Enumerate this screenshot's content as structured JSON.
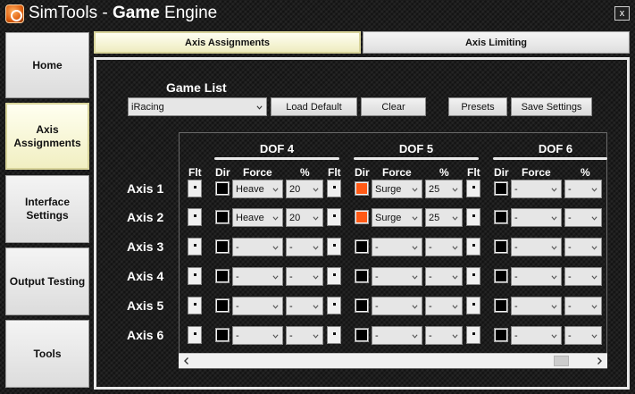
{
  "window": {
    "title_part1": "SimTools - ",
    "title_bold": "Game",
    "title_part2": " Engine",
    "close_label": "x"
  },
  "sidebar": {
    "items": [
      {
        "label": "Home"
      },
      {
        "label": "Axis Assignments"
      },
      {
        "label": "Interface Settings"
      },
      {
        "label": "Output Testing"
      },
      {
        "label": "Tools"
      }
    ],
    "active_index": 1
  },
  "tabs": [
    {
      "label": "Axis Assignments",
      "active": true
    },
    {
      "label": "Axis Limiting",
      "active": false
    }
  ],
  "game_list": {
    "label": "Game List",
    "selected": "iRacing"
  },
  "buttons": {
    "load_default": "Load Default",
    "clear": "Clear",
    "presets": "Presets",
    "save_settings": "Save Settings"
  },
  "dof_headers": [
    "DOF 4",
    "DOF 5",
    "DOF 6"
  ],
  "columns": {
    "dir": "Dir",
    "force": "Force",
    "percent": "%",
    "flt": "Flt"
  },
  "axes": [
    {
      "label": "Axis 1",
      "dof4": {
        "dir_on": false,
        "force": "Heave",
        "pct": "20"
      },
      "dof5": {
        "dir_on": true,
        "force": "Surge",
        "pct": "25"
      },
      "dof6": {
        "dir_on": false,
        "force": "-",
        "pct": "-"
      }
    },
    {
      "label": "Axis 2",
      "dof4": {
        "dir_on": false,
        "force": "Heave",
        "pct": "20"
      },
      "dof5": {
        "dir_on": true,
        "force": "Surge",
        "pct": "25"
      },
      "dof6": {
        "dir_on": false,
        "force": "-",
        "pct": "-"
      }
    },
    {
      "label": "Axis 3",
      "dof4": {
        "dir_on": false,
        "force": "-",
        "pct": "-"
      },
      "dof5": {
        "dir_on": false,
        "force": "-",
        "pct": "-"
      },
      "dof6": {
        "dir_on": false,
        "force": "-",
        "pct": "-"
      }
    },
    {
      "label": "Axis 4",
      "dof4": {
        "dir_on": false,
        "force": "-",
        "pct": "-"
      },
      "dof5": {
        "dir_on": false,
        "force": "-",
        "pct": "-"
      },
      "dof6": {
        "dir_on": false,
        "force": "-",
        "pct": "-"
      }
    },
    {
      "label": "Axis 5",
      "dof4": {
        "dir_on": false,
        "force": "-",
        "pct": "-"
      },
      "dof5": {
        "dir_on": false,
        "force": "-",
        "pct": "-"
      },
      "dof6": {
        "dir_on": false,
        "force": "-",
        "pct": "-"
      }
    },
    {
      "label": "Axis 6",
      "dof4": {
        "dir_on": false,
        "force": "-",
        "pct": "-"
      },
      "dof5": {
        "dir_on": false,
        "force": "-",
        "pct": "-"
      },
      "dof6": {
        "dir_on": false,
        "force": "-",
        "pct": "-"
      }
    }
  ],
  "colors": {
    "accent_orange": "#ff5a16",
    "highlight_yellow": "#f1efc2"
  }
}
